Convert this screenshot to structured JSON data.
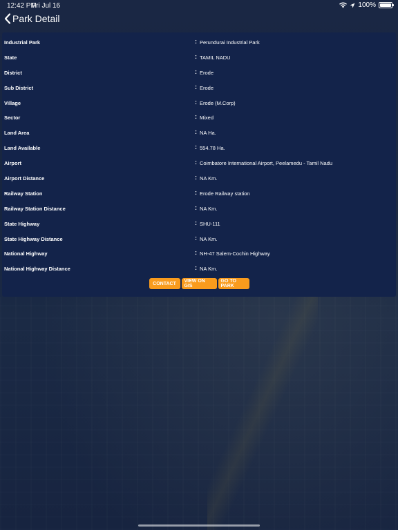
{
  "status_bar": {
    "time": "12:42 PM",
    "date": "Fri Jul 16",
    "battery": "100%",
    "icons": [
      "wifi-icon",
      "location-icon",
      "battery-icon"
    ]
  },
  "nav": {
    "title": "Park Detail",
    "back_icon": "chevron-left-icon"
  },
  "details": [
    {
      "label": "Industrial Park",
      "value": "Perundurai Industrial Park"
    },
    {
      "label": "State",
      "value": "TAMIL NADU"
    },
    {
      "label": "District",
      "value": "Erode"
    },
    {
      "label": "Sub District",
      "value": "Erode"
    },
    {
      "label": "Village",
      "value": "Erode (M.Corp)"
    },
    {
      "label": "Sector",
      "value": "Mixed"
    },
    {
      "label": "Land Area",
      "value": "NA Ha."
    },
    {
      "label": "Land Available",
      "value": "554.78 Ha."
    },
    {
      "label": "Airport",
      "value": "Coimbatore International Airport, Peelamedu - Tamil Nadu"
    },
    {
      "label": "Airport Distance",
      "value": "NA Km."
    },
    {
      "label": "Railway Station",
      "value": "Erode Railway station"
    },
    {
      "label": "Railway Station Distance",
      "value": "NA Km."
    },
    {
      "label": "State Highway",
      "value": "SHU-111"
    },
    {
      "label": "State Highway Distance",
      "value": "NA Km."
    },
    {
      "label": "National Highway",
      "value": "NH-47 Salem-Cochin Highway"
    },
    {
      "label": "National Highway Distance",
      "value": "NA Km."
    }
  ],
  "separator": ":",
  "actions": {
    "contact": "CONTACT",
    "view_on_gis": "VIEW ON GIS",
    "go_to_park": "GO TO PARK"
  },
  "colors": {
    "background": "#17253f",
    "card": "#13234a",
    "accent_button": "#f99b1d",
    "text": "#ffffff"
  }
}
